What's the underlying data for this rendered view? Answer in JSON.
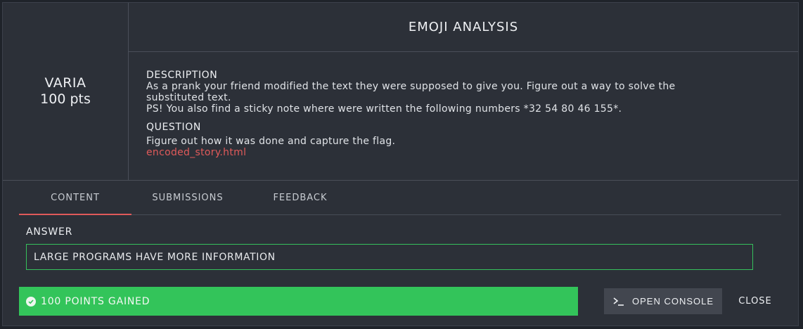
{
  "challenge": {
    "category": "VARIA",
    "points": "100 pts",
    "title": "EMOJI ANALYSIS"
  },
  "description": {
    "heading": "DESCRIPTION",
    "line1": "As a prank your friend modified the text they were supposed to give you. Figure out a way to solve the",
    "line2": "substituted text.",
    "line3": "PS! You also find a sticky note where were written the following numbers *32 54 80 46 155*."
  },
  "question": {
    "heading": "QUESTION",
    "text": "Figure out how it was done and capture the flag.",
    "file_link": "encoded_story.html"
  },
  "tabs": [
    {
      "label": "CONTENT",
      "active": true
    },
    {
      "label": "SUBMISSIONS",
      "active": false
    },
    {
      "label": "FEEDBACK",
      "active": false
    }
  ],
  "answer": {
    "label": "ANSWER",
    "value": "LARGE PROGRAMS HAVE MORE INFORMATION"
  },
  "status": {
    "text": "100 POINTS GAINED",
    "color": "#33c45a"
  },
  "actions": {
    "open_console": "OPEN CONSOLE",
    "close": "CLOSE"
  },
  "colors": {
    "accent": "#e05a5a",
    "success": "#33c45a",
    "background": "#2c3038"
  }
}
